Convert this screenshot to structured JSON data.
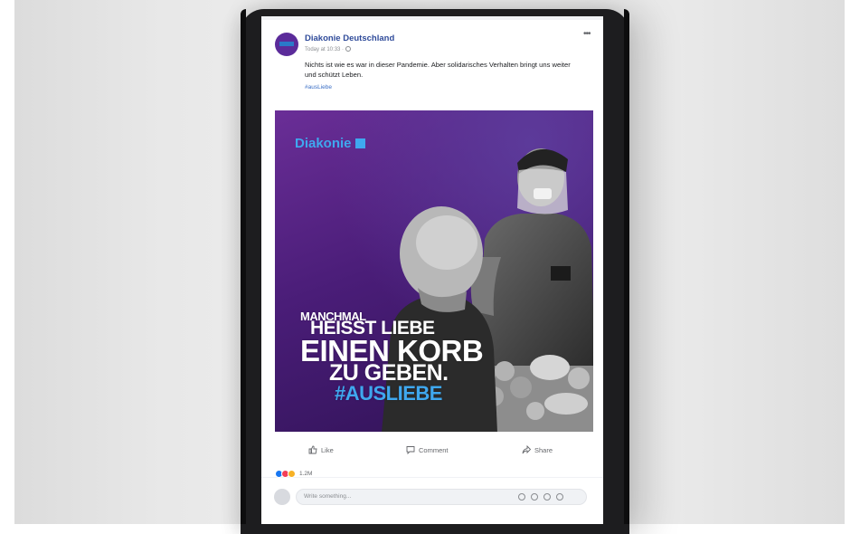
{
  "post": {
    "page_name": "Diakonie Deutschland",
    "meta": "Today at 10:33 ·",
    "text": "Nichts ist wie es war in dieser Pandemie. Aber solidarisches Verhalten bringt uns weiter und schützt Leben.",
    "hashtag": "#ausLiebe"
  },
  "image": {
    "brand_logo": "Diakonie",
    "headline": [
      "MANCHMAL",
      "HEISST LIEBE",
      "EINEN KORB",
      "ZU GEBEN.",
      "#AUSLIEBE"
    ]
  },
  "actions": {
    "like": "Like",
    "comment": "Comment",
    "share": "Share"
  },
  "reactions": {
    "count": "1.2M"
  },
  "comment_box": {
    "placeholder": "Write something..."
  },
  "colors": {
    "accent_blue": "#3fa8ef",
    "purple_background": "#4a1d78",
    "link_blue": "#2f4b9a"
  },
  "icons": [
    "more-icon",
    "globe-icon",
    "like-icon",
    "comment-icon",
    "share-icon",
    "emoji-icon",
    "camera-icon",
    "gif-icon",
    "sticker-icon"
  ]
}
